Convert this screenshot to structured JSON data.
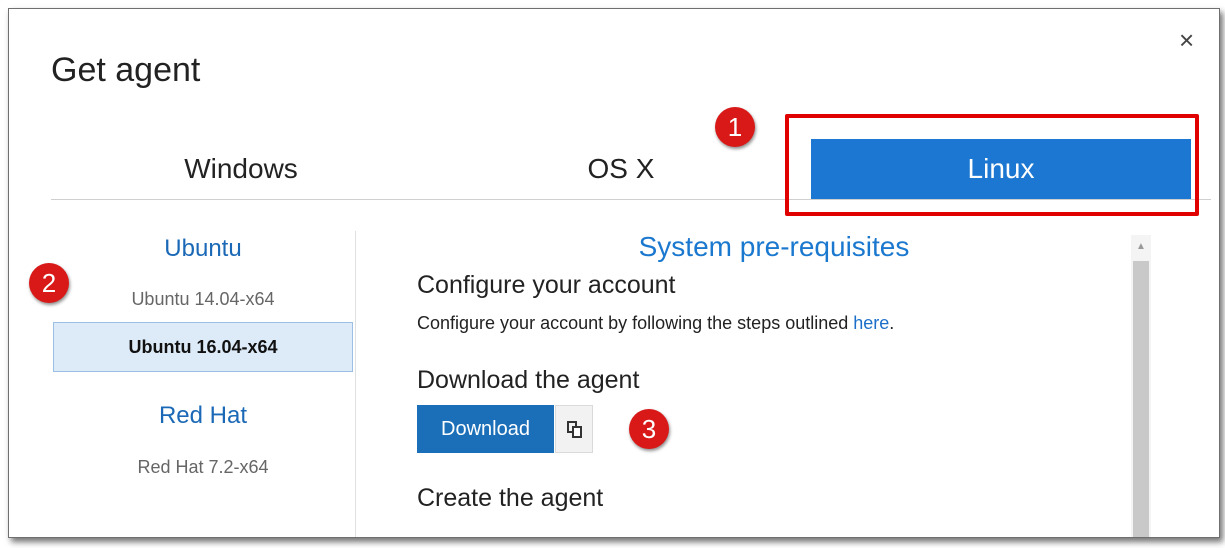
{
  "dialog": {
    "title": "Get agent",
    "close_label": "×"
  },
  "tabs": {
    "windows": "Windows",
    "osx": "OS X",
    "linux": "Linux",
    "selected": "Linux"
  },
  "sidebar": {
    "groups": [
      {
        "heading": "Ubuntu",
        "items": [
          "Ubuntu 14.04-x64",
          "Ubuntu 16.04-x64"
        ]
      },
      {
        "heading": "Red Hat",
        "items": [
          "Red Hat 7.2-x64"
        ]
      }
    ],
    "selected_item": "Ubuntu 16.04-x64"
  },
  "main": {
    "heading": "System pre-requisites",
    "configure_title": "Configure your account",
    "configure_text": "Configure your account by following the steps outlined ",
    "configure_link": "here",
    "configure_suffix": ".",
    "download_title": "Download the agent",
    "download_button": "Download",
    "create_title": "Create the agent"
  },
  "annotations": {
    "badge1": "1",
    "badge2": "2",
    "badge3": "3",
    "color": "#d91818"
  },
  "icons": {
    "close": "close-icon",
    "copy": "copy-icon",
    "scroll_up": "scroll-up-arrow-icon"
  },
  "colors": {
    "accent": "#1b77d2",
    "link": "#1b6fc8",
    "highlight": "#e00000"
  }
}
